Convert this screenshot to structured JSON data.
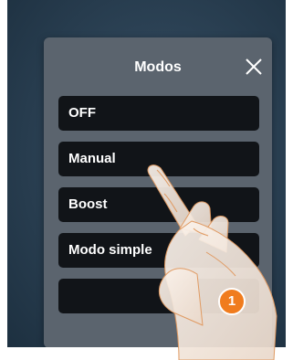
{
  "dialog": {
    "title": "Modos",
    "close_icon": "close-icon",
    "items": [
      {
        "label": "OFF"
      },
      {
        "label": "Manual"
      },
      {
        "label": "Boost"
      },
      {
        "label": "Modo simple"
      },
      {
        "label": ""
      }
    ]
  },
  "callout": {
    "step": "1"
  },
  "colors": {
    "screen_background": "#2c4255",
    "panel_background": "#5b646e",
    "item_background": "#111418",
    "badge": "#f07c1e"
  }
}
